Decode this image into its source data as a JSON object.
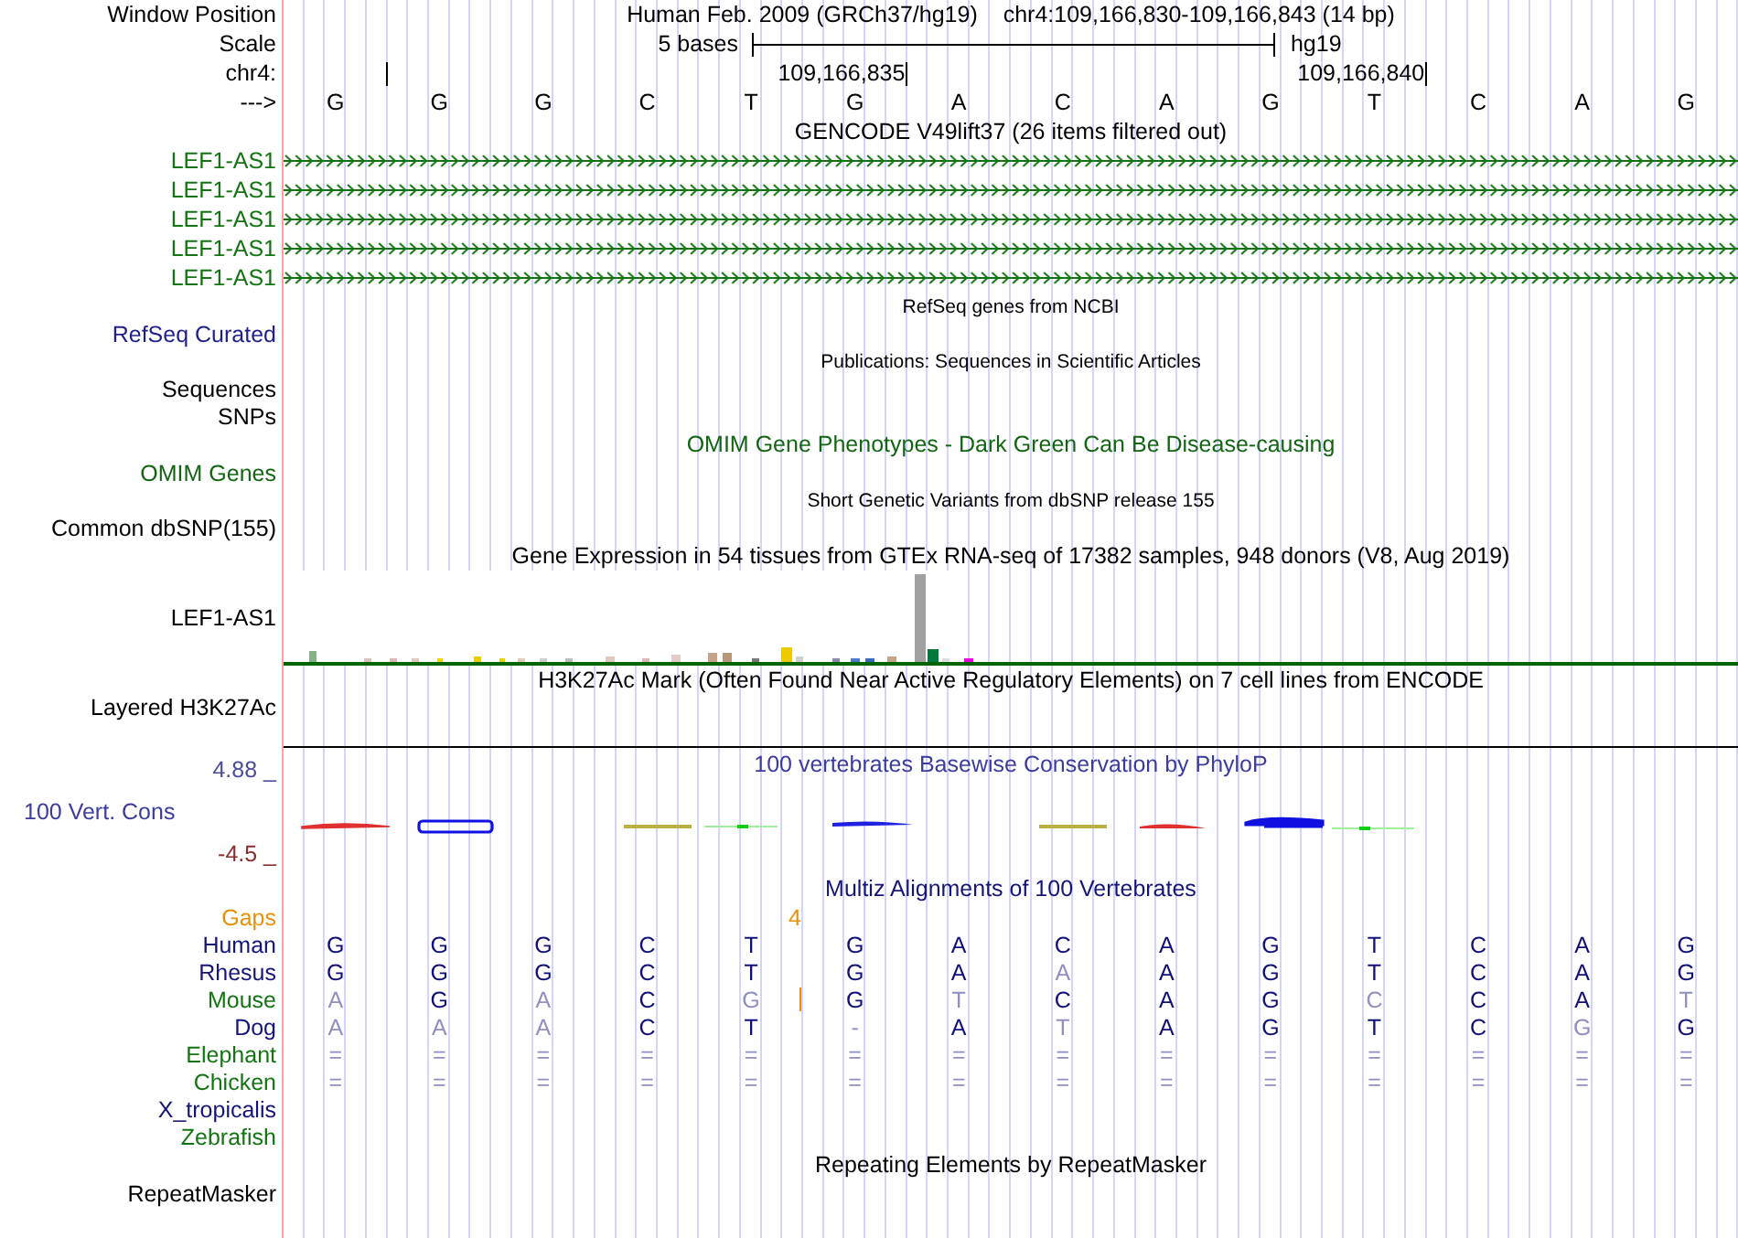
{
  "header": {
    "position_label": "Window Position",
    "assembly": "Human Feb. 2009 (GRCh37/hg19)",
    "position": "chr4:109,166,830-109,166,843 (14 bp)",
    "scale_label": "Scale",
    "scale": "5 bases",
    "scale_assembly": "hg19",
    "chrom_label": "chr4:",
    "ticks": [
      "109,166,835",
      "109,166,840"
    ],
    "strand_label": "--->",
    "bases": [
      "G",
      "G",
      "G",
      "C",
      "T",
      "G",
      "A",
      "C",
      "A",
      "G",
      "T",
      "C",
      "A",
      "G"
    ]
  },
  "rows": [
    {
      "kind": "title",
      "text": "GENCODE V49lift37 (26 items filtered out)",
      "color": "#000000"
    },
    {
      "kind": "gene",
      "label": "LEF1-AS1",
      "color": "#127512"
    },
    {
      "kind": "gene",
      "label": "LEF1-AS1",
      "color": "#127512"
    },
    {
      "kind": "gene",
      "label": "LEF1-AS1",
      "color": "#127512"
    },
    {
      "kind": "gene",
      "label": "LEF1-AS1",
      "color": "#127512"
    },
    {
      "kind": "gene",
      "label": "LEF1-AS1",
      "color": "#127512"
    },
    {
      "kind": "small-title",
      "text": "RefSeq genes from NCBI",
      "color": "#000000"
    },
    {
      "kind": "label",
      "label": "RefSeq Curated",
      "color": "#1f1f8c"
    },
    {
      "kind": "small-title",
      "text": "Publications: Sequences in Scientific Articles",
      "color": "#000000"
    },
    {
      "kind": "label",
      "label": "Sequences",
      "color": "#000000"
    },
    {
      "kind": "label",
      "label": "SNPs",
      "color": "#000000"
    },
    {
      "kind": "title",
      "text": "OMIM Gene Phenotypes - Dark Green Can Be Disease-causing",
      "color": "#126612"
    },
    {
      "kind": "label",
      "label": "OMIM Genes",
      "color": "#126612"
    },
    {
      "kind": "small-title",
      "text": "Short Genetic Variants from dbSNP release 155",
      "color": "#000000"
    },
    {
      "kind": "label",
      "label": "Common dbSNP(155)",
      "color": "#000000"
    },
    {
      "kind": "title",
      "text": "Gene Expression in 54 tissues from GTEx RNA-seq of 17382 samples, 948 donors (V8, Aug 2019)",
      "color": "#000000"
    },
    {
      "kind": "expression",
      "label": "LEF1-AS1",
      "color": "#000000"
    },
    {
      "kind": "title",
      "text": "H3K27Ac Mark (Often Found Near Active Regulatory Elements) on 7 cell lines from ENCODE",
      "color": "#000000"
    },
    {
      "kind": "signal",
      "label": "Layered H3K27Ac",
      "color": "#000000"
    },
    {
      "kind": "conservation",
      "text": "100 vertebrates Basewise Conservation by PhyloP",
      "label": "100 Vert. Cons",
      "color": "#3c3ca0",
      "max": "4.88 _",
      "min": "-4.5 _"
    },
    {
      "kind": "title",
      "text": "Multiz Alignments of 100 Vertebrates",
      "color": "#14147a"
    },
    {
      "kind": "gaps",
      "label": "Gaps",
      "color": "#e8900a",
      "count": "4"
    },
    {
      "kind": "species",
      "label": "Human",
      "color": "#14147a",
      "bases": [
        {
          "text": "G",
          "faded": false,
          "insertion": false
        },
        {
          "text": "G",
          "faded": false,
          "insertion": false
        },
        {
          "text": "G",
          "faded": false,
          "insertion": false
        },
        {
          "text": "C",
          "faded": false,
          "insertion": false
        },
        {
          "text": "T",
          "faded": false,
          "insertion": false
        },
        {
          "text": "G",
          "faded": false,
          "insertion": false
        },
        {
          "text": "A",
          "faded": false,
          "insertion": false
        },
        {
          "text": "C",
          "faded": false,
          "insertion": false
        },
        {
          "text": "A",
          "faded": false,
          "insertion": false
        },
        {
          "text": "G",
          "faded": false,
          "insertion": false
        },
        {
          "text": "T",
          "faded": false,
          "insertion": false
        },
        {
          "text": "C",
          "faded": false,
          "insertion": false
        },
        {
          "text": "A",
          "faded": false,
          "insertion": false
        },
        {
          "text": "G",
          "faded": false,
          "insertion": false
        }
      ]
    },
    {
      "kind": "species",
      "label": "Rhesus",
      "color": "#14147a",
      "bases": [
        {
          "text": "G",
          "faded": false,
          "insertion": false
        },
        {
          "text": "G",
          "faded": false,
          "insertion": false
        },
        {
          "text": "G",
          "faded": false,
          "insertion": false
        },
        {
          "text": "C",
          "faded": false,
          "insertion": false
        },
        {
          "text": "T",
          "faded": false,
          "insertion": false
        },
        {
          "text": "G",
          "faded": false,
          "insertion": false
        },
        {
          "text": "A",
          "faded": false,
          "insertion": false
        },
        {
          "text": "A",
          "faded": true,
          "insertion": false
        },
        {
          "text": "A",
          "faded": false,
          "insertion": false
        },
        {
          "text": "G",
          "faded": false,
          "insertion": false
        },
        {
          "text": "T",
          "faded": false,
          "insertion": false
        },
        {
          "text": "C",
          "faded": false,
          "insertion": false
        },
        {
          "text": "A",
          "faded": false,
          "insertion": false
        },
        {
          "text": "G",
          "faded": false,
          "insertion": false
        }
      ]
    },
    {
      "kind": "species",
      "label": "Mouse",
      "color": "#127512",
      "bases": [
        {
          "text": "A",
          "faded": true,
          "insertion": false
        },
        {
          "text": "G",
          "faded": false,
          "insertion": false
        },
        {
          "text": "A",
          "faded": true,
          "insertion": false
        },
        {
          "text": "C",
          "faded": false,
          "insertion": false
        },
        {
          "text": "G",
          "faded": true,
          "insertion": true
        },
        {
          "text": "G",
          "faded": false,
          "insertion": false
        },
        {
          "text": "T",
          "faded": true,
          "insertion": false
        },
        {
          "text": "C",
          "faded": false,
          "insertion": false
        },
        {
          "text": "A",
          "faded": false,
          "insertion": false
        },
        {
          "text": "G",
          "faded": false,
          "insertion": false
        },
        {
          "text": "C",
          "faded": true,
          "insertion": false
        },
        {
          "text": "C",
          "faded": false,
          "insertion": false
        },
        {
          "text": "A",
          "faded": false,
          "insertion": false
        },
        {
          "text": "T",
          "faded": true,
          "insertion": false
        }
      ]
    },
    {
      "kind": "species",
      "label": "Dog",
      "color": "#14147a",
      "bases": [
        {
          "text": "A",
          "faded": true,
          "insertion": false
        },
        {
          "text": "A",
          "faded": true,
          "insertion": false
        },
        {
          "text": "A",
          "faded": true,
          "insertion": false
        },
        {
          "text": "C",
          "faded": false,
          "insertion": false
        },
        {
          "text": "T",
          "faded": false,
          "insertion": false
        },
        {
          "text": "-",
          "faded": true,
          "insertion": false
        },
        {
          "text": "A",
          "faded": false,
          "insertion": false
        },
        {
          "text": "T",
          "faded": true,
          "insertion": false
        },
        {
          "text": "A",
          "faded": false,
          "insertion": false
        },
        {
          "text": "G",
          "faded": false,
          "insertion": false
        },
        {
          "text": "T",
          "faded": false,
          "insertion": false
        },
        {
          "text": "C",
          "faded": false,
          "insertion": false
        },
        {
          "text": "G",
          "faded": true,
          "insertion": false
        },
        {
          "text": "G",
          "faded": false,
          "insertion": false
        }
      ]
    },
    {
      "kind": "species",
      "label": "Elephant",
      "color": "#127512",
      "bases": [
        {
          "text": "=",
          "faded": true,
          "insertion": false
        },
        {
          "text": "=",
          "faded": true,
          "insertion": false
        },
        {
          "text": "=",
          "faded": true,
          "insertion": false
        },
        {
          "text": "=",
          "faded": true,
          "insertion": false
        },
        {
          "text": "=",
          "faded": true,
          "insertion": false
        },
        {
          "text": "=",
          "faded": true,
          "insertion": false
        },
        {
          "text": "=",
          "faded": true,
          "insertion": false
        },
        {
          "text": "=",
          "faded": true,
          "insertion": false
        },
        {
          "text": "=",
          "faded": true,
          "insertion": false
        },
        {
          "text": "=",
          "faded": true,
          "insertion": false
        },
        {
          "text": "=",
          "faded": true,
          "insertion": false
        },
        {
          "text": "=",
          "faded": true,
          "insertion": false
        },
        {
          "text": "=",
          "faded": true,
          "insertion": false
        },
        {
          "text": "=",
          "faded": true,
          "insertion": false
        }
      ]
    },
    {
      "kind": "species",
      "label": "Chicken",
      "color": "#127512",
      "bases": [
        {
          "text": "=",
          "faded": true,
          "insertion": false
        },
        {
          "text": "=",
          "faded": true,
          "insertion": false
        },
        {
          "text": "=",
          "faded": true,
          "insertion": false
        },
        {
          "text": "=",
          "faded": true,
          "insertion": false
        },
        {
          "text": "=",
          "faded": true,
          "insertion": false
        },
        {
          "text": "=",
          "faded": true,
          "insertion": false
        },
        {
          "text": "=",
          "faded": true,
          "insertion": false
        },
        {
          "text": "=",
          "faded": true,
          "insertion": false
        },
        {
          "text": "=",
          "faded": true,
          "insertion": false
        },
        {
          "text": "=",
          "faded": true,
          "insertion": false
        },
        {
          "text": "=",
          "faded": true,
          "insertion": false
        },
        {
          "text": "=",
          "faded": true,
          "insertion": false
        },
        {
          "text": "=",
          "faded": true,
          "insertion": false
        },
        {
          "text": "=",
          "faded": true,
          "insertion": false
        }
      ]
    },
    {
      "kind": "species",
      "label": "X_tropicalis",
      "color": "#14147a"
    },
    {
      "kind": "species",
      "label": "Zebrafish",
      "color": "#127512"
    },
    {
      "kind": "title",
      "text": "Repeating Elements by RepeatMasker",
      "color": "#000000"
    },
    {
      "kind": "label",
      "label": "RepeatMasker",
      "color": "#000000"
    }
  ]
}
